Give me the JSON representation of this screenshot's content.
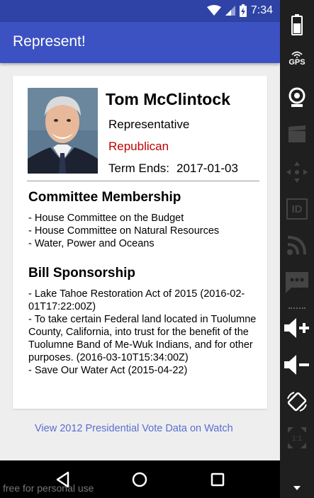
{
  "status_bar": {
    "time": "7:34"
  },
  "app_bar": {
    "title": "Represent!"
  },
  "representative": {
    "name": "Tom McClintock",
    "title": "Representative",
    "party": "Republican",
    "term_label": "Term Ends:",
    "term_date": "2017-01-03"
  },
  "committee": {
    "heading": "Committee Membership",
    "items": [
      "- House Committee on the Budget",
      "- House Committee on Natural Resources",
      "- Water, Power and Oceans"
    ]
  },
  "bills": {
    "heading": "Bill Sponsorship",
    "items": [
      "- Lake Tahoe Restoration Act of 2015 (2016-02-01T17:22:00Z)",
      "- To take certain Federal land located in Tuolumne County, California, into trust for the benefit of the Tuolumne Band of Me-Wuk Indians, and for other purposes. (2016-03-10T15:34:00Z)",
      "- Save Our Water Act (2015-04-22)"
    ]
  },
  "watch_link": "View 2012 Presidential Vote Data on Watch",
  "watermark": "free for personal use",
  "emulator_panel": {
    "gps_label": "GPS",
    "id_label": "ID",
    "icons": [
      "battery-icon",
      "gps-icon",
      "camera-icon",
      "video-icon",
      "dpad-icon",
      "id-icon",
      "rss-icon",
      "sms-icon",
      "volume-up-icon",
      "volume-down-icon",
      "rotate-icon",
      "scale-icon",
      "chevron-down-icon"
    ]
  },
  "colors": {
    "status_bar": "#2e43a5",
    "app_bar": "#3c52c2",
    "party": "#c00000",
    "link": "#5a6fd0",
    "background": "#eeeeee"
  }
}
